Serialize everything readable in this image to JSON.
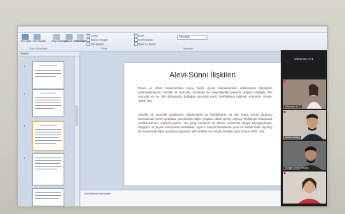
{
  "menubar": {
    "items": [
      "Dosya",
      "Giriş",
      "Ekle",
      "Tasarım",
      "Animasyonlar",
      "Slayt Gösterisi",
      "Gözden Geçir",
      "Görünüm"
    ]
  },
  "ribbon": {
    "buttons": [
      "Yeni Slayt",
      "Tüm Slaytlar",
      "Slayt Sıralayıcı",
      "Okuma Görünümü",
      "Not Sayfası"
    ],
    "checks": [
      "Cetvel",
      "Kılavuz Çizgiler",
      "Not Sayfası",
      "Renk",
      "Gri Tonlamalı",
      "Siyah ve Beyaz"
    ],
    "select_value": "Yakınlaştır",
    "group_labels": [
      "Sunu Görünümleri",
      "Göster",
      "Yakınlaştır"
    ]
  },
  "left_pane": {
    "tab_label": "Slaytlar",
    "slide_numbers": [
      "1",
      "2",
      "3",
      "4"
    ]
  },
  "slide": {
    "title": "Alevi-Sünni İlişkileri",
    "para1": "Diner ve Ahlat Nedenlerden İnanç tarihi içerisi makalelerden etkilenerek düşüşünü yetkuladıklarıdır. Alevilik ve Sünnilik, Özelinde da sosyolojideki yaşantı değişim değişiki dair inançlar ve bu dini dünyasıda doğağan amaçlar yazıl, farklılıklara rağmen yönünde. (Kaya, 2009: 35)",
    "para2": "Alevilik ve Sünnilik gruplarının ilişkisindeki bu farklılıklarla da her inanç temel grubunu tarımlamak temel gruplara yanıltılırları diğer grupları daha geniş, diyloçe ilişkilerde bulunarak sekiilikizarının, yaşama gelen. Her grup kendisini de dönen çıkarmak ortaya koyuşunıtlaştı, değişimi ve siyasi süreçlerde farklılıklar; ayrıca sosyal Dinsizlerle yeni bir dahile farklı diyalog ile bulunarak diğer gruplara yaşamla milli birlikler ve sosyal kimliğe çatış (Kaya 2002: 84)."
  },
  "notes": {
    "placeholder": "Not eklemek için tıklatın"
  },
  "participants": {
    "observer_label": "Observer H-1",
    "tiles": [
      {
        "name": "Observer H-1"
      },
      {
        "name": "Hasan Atalay"
      },
      {
        "name": "Kürşat Semih Ertuğrul"
      },
      {
        "name": ""
      }
    ]
  },
  "colors": {
    "ribbon_bg": "#e4ebf4",
    "app_bg": "#cdd8e6",
    "panel_bg": "#1c1d20",
    "selected_thumb": "#f1b53d"
  }
}
